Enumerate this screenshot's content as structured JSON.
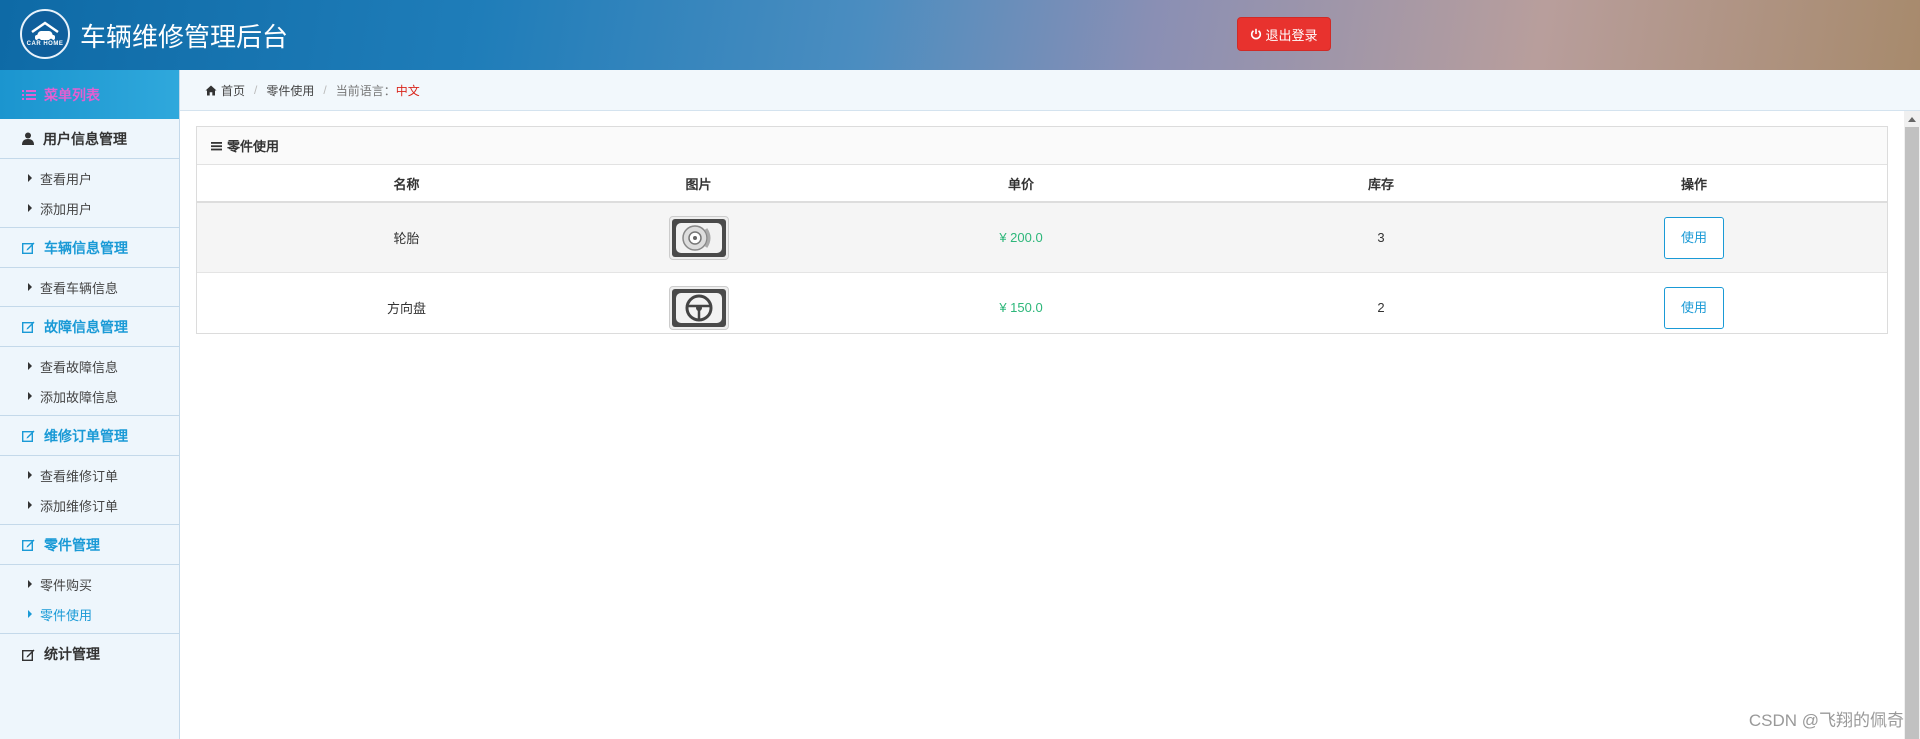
{
  "header": {
    "app_title": "车辆维修管理后台",
    "logo_text": "CAR HOME",
    "logout_label": "退出登录",
    "logout_color": "#e8322e"
  },
  "sidebar": {
    "menu_title": "菜单列表",
    "groups": [
      {
        "title": "用户信息管理",
        "icon": "user-icon",
        "items": [
          "查看用户",
          "添加用户"
        ]
      },
      {
        "title": "车辆信息管理",
        "icon": "edit-icon",
        "items": [
          "查看车辆信息"
        ]
      },
      {
        "title": "故障信息管理",
        "icon": "edit-icon",
        "items": [
          "查看故障信息",
          "添加故障信息"
        ]
      },
      {
        "title": "维修订单管理",
        "icon": "edit-icon",
        "items": [
          "查看维修订单",
          "添加维修订单"
        ]
      },
      {
        "title": "零件管理",
        "icon": "edit-icon",
        "items": [
          "零件购买",
          "零件使用"
        ],
        "active_item": "零件使用"
      },
      {
        "title": "统计管理",
        "icon": "edit-icon",
        "items": []
      }
    ]
  },
  "breadcrumb": {
    "home": "首页",
    "current": "零件使用",
    "lang_label": "当前语言：",
    "lang_value": "中文"
  },
  "panel": {
    "title": "零件使用",
    "columns": [
      "名称",
      "图片",
      "单价",
      "库存",
      "操作"
    ],
    "rows": [
      {
        "name": "轮胎",
        "image": "tire-icon",
        "price": "¥ 200.0",
        "stock": "3",
        "action": "使用"
      },
      {
        "name": "方向盘",
        "image": "steering-wheel-icon",
        "price": "¥ 150.0",
        "stock": "2",
        "action": "使用"
      }
    ]
  },
  "watermark": "CSDN @飞翔的佩奇",
  "colors": {
    "accent": "#1a9ad6",
    "price": "#2db77a",
    "lang": "#d9261c"
  }
}
